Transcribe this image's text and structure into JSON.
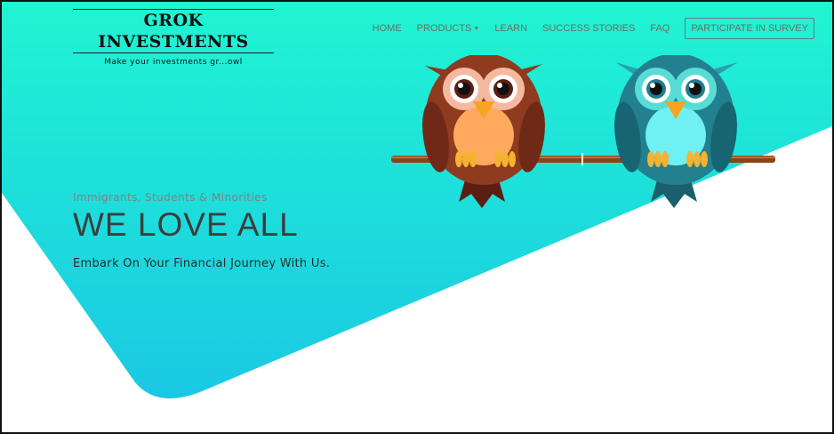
{
  "brand": {
    "title": "GROK INVESTMENTS",
    "tagline": "Make your investments gr...owl"
  },
  "nav": {
    "items": [
      {
        "label": "HOME",
        "has_caret": false
      },
      {
        "label": "PRODUCTS",
        "has_caret": true
      },
      {
        "label": "LEARN",
        "has_caret": false
      },
      {
        "label": "SUCCESS STORIES",
        "has_caret": false
      },
      {
        "label": "FAQ",
        "has_caret": false
      }
    ],
    "survey_button": "PARTICIPATE IN SURVEY"
  },
  "hero": {
    "eyebrow": "Immigrants, Students & Minorities",
    "headline": "WE LOVE ALL",
    "subline": "Embark On Your Financial Journey With Us."
  },
  "colors": {
    "gradient_top": "#1ff3d0",
    "gradient_bottom": "#1cc9e3",
    "brown_owl": "#8a3a1e",
    "teal_owl": "#1f7d8c",
    "branch": "#8b4513"
  }
}
